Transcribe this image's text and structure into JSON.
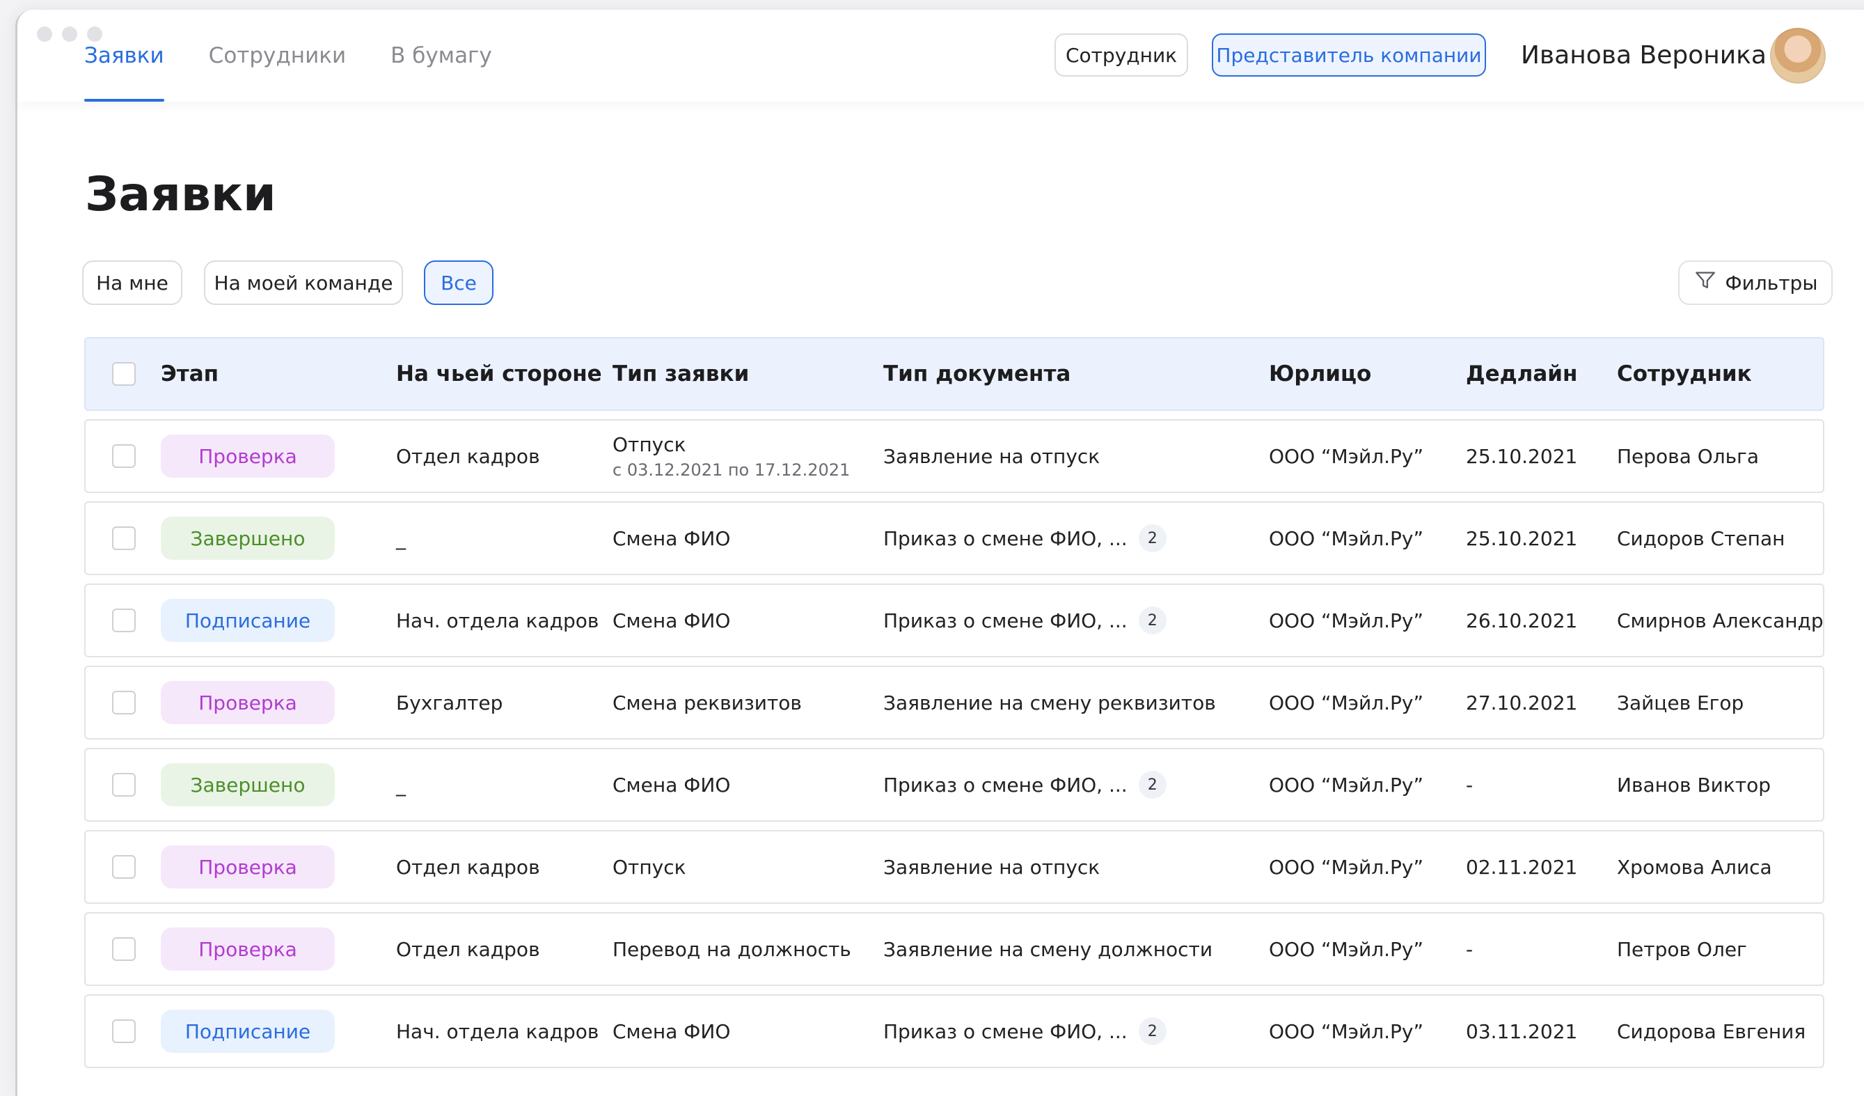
{
  "nav": {
    "tabs": [
      "Заявки",
      "Сотрудники",
      "В бумагу"
    ]
  },
  "roles": {
    "employee": "Сотрудник",
    "representative": "Представитель компании"
  },
  "user": {
    "name": "Иванова Вероника"
  },
  "page": {
    "title": "Заявки"
  },
  "filters": {
    "chips": [
      "На мне",
      "На моей команде",
      "Все"
    ],
    "button_label": "Фильтры"
  },
  "table": {
    "headers": [
      "Этап",
      "На чьей стороне",
      "Тип заявки",
      "Тип документа",
      "Юрлицо",
      "Дедлайн",
      "Сотрудник"
    ],
    "rows": [
      {
        "stage": "Проверка",
        "side": "Отдел кадров",
        "type": "Отпуск",
        "type_sub": "с 03.12.2021 по 17.12.2021",
        "doc": "Заявление на отпуск",
        "count": "",
        "entity": "ООО “Мэйл.Ру”",
        "deadline": "25.10.2021",
        "employee": "Перова Ольга"
      },
      {
        "stage": "Завершено",
        "side": "_",
        "type": "Смена ФИО",
        "type_sub": "",
        "doc": "Приказ о смене ФИО, ...",
        "count": "2",
        "entity": "ООО “Мэйл.Ру”",
        "deadline": "25.10.2021",
        "employee": "Сидоров Степан"
      },
      {
        "stage": "Подписание",
        "side": "Нач. отдела кадров",
        "type": "Смена ФИО",
        "type_sub": "",
        "doc": "Приказ о смене ФИО, ...",
        "count": "2",
        "entity": "ООО “Мэйл.Ру”",
        "deadline": "26.10.2021",
        "employee": "Смирнов Александр"
      },
      {
        "stage": "Проверка",
        "side": "Бухгалтер",
        "type": "Смена реквизитов",
        "type_sub": "",
        "doc": "Заявление на смену реквизитов",
        "count": "",
        "entity": "ООО “Мэйл.Ру”",
        "deadline": "27.10.2021",
        "employee": "Зайцев Егор"
      },
      {
        "stage": "Завершено",
        "side": "_",
        "type": "Смена ФИО",
        "type_sub": "",
        "doc": "Приказ о смене ФИО, ...",
        "count": "2",
        "entity": "ООО “Мэйл.Ру”",
        "deadline": "-",
        "employee": "Иванов Виктор"
      },
      {
        "stage": "Проверка",
        "side": "Отдел кадров",
        "type": "Отпуск",
        "type_sub": "",
        "doc": "Заявление на отпуск",
        "count": "",
        "entity": "ООО “Мэйл.Ру”",
        "deadline": "02.11.2021",
        "employee": "Хромова Алиса"
      },
      {
        "stage": "Проверка",
        "side": "Отдел кадров",
        "type": "Перевод на должность",
        "type_sub": "",
        "doc": "Заявление на смену должности",
        "count": "",
        "entity": "ООО “Мэйл.Ру”",
        "deadline": "-",
        "employee": "Петров Олег"
      },
      {
        "stage": "Подписание",
        "side": "Нач. отдела кадров",
        "type": "Смена ФИО",
        "type_sub": "",
        "doc": "Приказ о смене ФИО, ...",
        "count": "2",
        "entity": "ООО “Мэйл.Ру”",
        "deadline": "03.11.2021",
        "employee": "Сидорова Евгения"
      }
    ]
  },
  "colors": {
    "accent": "#2a6de0",
    "proverka": "#b23bd1",
    "zaversheno": "#4a8f2a",
    "podpisanie": "#2a6de0"
  }
}
